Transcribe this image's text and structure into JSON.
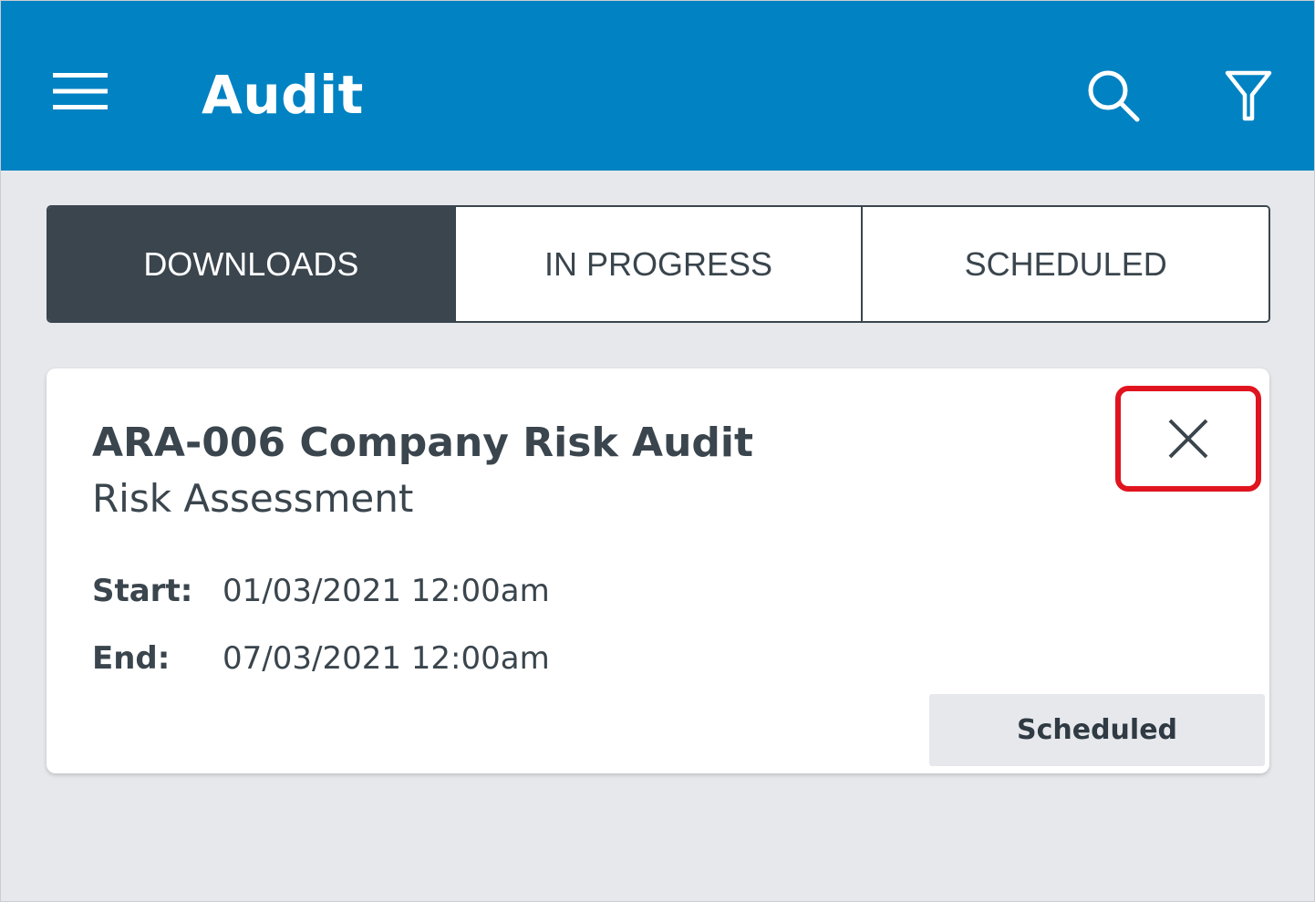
{
  "appbar": {
    "title": "Audit",
    "menu_icon": "hamburger-menu-icon",
    "search_icon": "search-icon",
    "filter_icon": "filter-icon",
    "background_color": "#0082c3"
  },
  "tabs": [
    {
      "label": "DOWNLOADS",
      "active": true
    },
    {
      "label": "IN PROGRESS",
      "active": false
    },
    {
      "label": "SCHEDULED",
      "active": false
    }
  ],
  "audit_card": {
    "title": "ARA-006 Company Risk Audit",
    "subtitle": "Risk Assessment",
    "start_label": "Start:",
    "start_value": "01/03/2021 12:00am",
    "end_label": "End:",
    "end_value": "07/03/2021 12:00am",
    "status": "Scheduled",
    "close_icon": "close-icon",
    "highlight_color": "#e0141e"
  },
  "colors": {
    "page_background": "#e6e8ec",
    "tab_active_background": "#3a454d",
    "text_dark": "#3a454d"
  }
}
